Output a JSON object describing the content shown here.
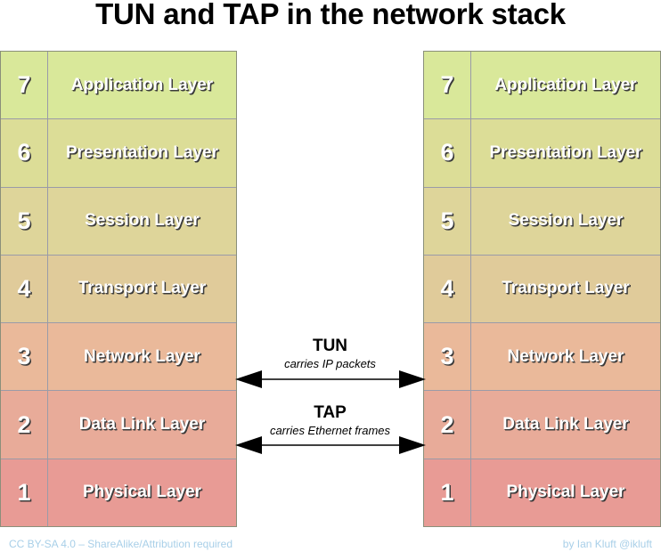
{
  "title": "TUN and TAP in the network stack",
  "stacks": {
    "left_name": "osi-stack-left",
    "right_name": "osi-stack-right",
    "layers": [
      {
        "number": "7",
        "name": "Application Layer",
        "color": "#d9e89a"
      },
      {
        "number": "6",
        "name": "Presentation Layer",
        "color": "#dcdd97"
      },
      {
        "number": "5",
        "name": "Session Layer",
        "color": "#ded59a"
      },
      {
        "number": "4",
        "name": "Transport Layer",
        "color": "#e0cb9a"
      },
      {
        "number": "3",
        "name": "Network Layer",
        "color": "#eab99a"
      },
      {
        "number": "2",
        "name": "Data Link Layer",
        "color": "#e8ab99"
      },
      {
        "number": "1",
        "name": "Physical Layer",
        "color": "#e89b95"
      }
    ]
  },
  "tunnels": [
    {
      "title": "TUN",
      "subtitle": "carries IP packets",
      "at_layer": "3"
    },
    {
      "title": "TAP",
      "subtitle": "carries Ethernet frames",
      "at_layer": "2"
    }
  ],
  "footer": {
    "license": "CC BY-SA 4.0 – ShareAlike/Attribution required",
    "credit": "by Ian Kluft @ikluft",
    "color": "#a8cfe8"
  },
  "colors": {
    "background": "#ffffff",
    "title_text": "#000000",
    "layer_label_text": "#ffffff",
    "layer_label_shadow": "#3b3b3b",
    "grid_border": "#9a9ba8",
    "outer_border": "#8a8f7a",
    "arrow": "#000000"
  }
}
